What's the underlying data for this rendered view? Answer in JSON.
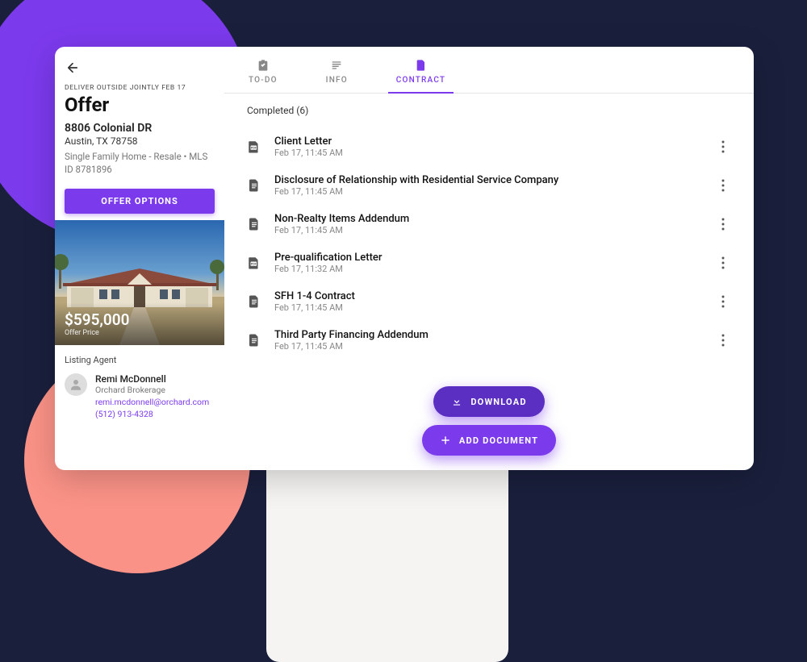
{
  "header": {
    "deliver_line": "DELIVER OUTSIDE JOINTLY FEB 17",
    "title": "Offer",
    "address": "8806 Colonial DR",
    "city_state": "Austin, TX 78758",
    "property_type": "Single Family Home - Resale • MLS ID 8781896"
  },
  "offer_options_label": "OFFER OPTIONS",
  "price": {
    "value": "$595,000",
    "label": "Offer Price"
  },
  "agent": {
    "section_label": "Listing Agent",
    "name": "Remi McDonnell",
    "brokerage": "Orchard Brokerage",
    "email": "remi.mcdonnell@orchard.com",
    "phone": "(512) 913-4328"
  },
  "tabs": [
    {
      "label": "TO-DO",
      "active": false
    },
    {
      "label": "INFO",
      "active": false
    },
    {
      "label": "CONTRACT",
      "active": true
    }
  ],
  "completed_label": "Completed (6)",
  "documents": [
    {
      "title": "Client Letter",
      "time": "Feb 17, 11:45 AM",
      "icon": "pdf"
    },
    {
      "title": "Disclosure of Relationship with Residential Service Company",
      "time": "Feb 17, 11:45 AM",
      "icon": "doc"
    },
    {
      "title": "Non-Realty Items Addendum",
      "time": "Feb 17, 11:45 AM",
      "icon": "doc"
    },
    {
      "title": "Pre-qualification Letter",
      "time": "Feb 17, 11:32 AM",
      "icon": "pdf"
    },
    {
      "title": "SFH 1-4 Contract",
      "time": "Feb 17, 11:45 AM",
      "icon": "doc"
    },
    {
      "title": "Third Party Financing Addendum",
      "time": "Feb 17, 11:45 AM",
      "icon": "doc"
    }
  ],
  "download_label": "DOWNLOAD",
  "add_document_label": "ADD DOCUMENT"
}
